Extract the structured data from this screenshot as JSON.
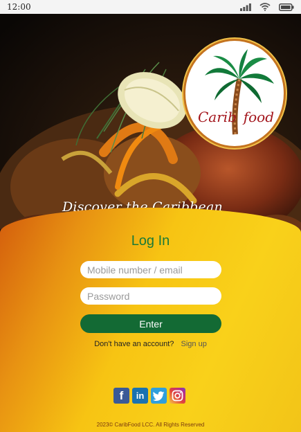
{
  "status_bar": {
    "time": "12:00"
  },
  "brand": {
    "logo_text_left": "Carib",
    "logo_text_right": "food",
    "tagline": "Discover the Caribbean Flava"
  },
  "login": {
    "title": "Log In",
    "username_placeholder": "Mobile number / email",
    "password_placeholder": "Password",
    "submit_label": "Enter",
    "signup_prompt": "Don't have an account?",
    "signup_link": "Sign up"
  },
  "socials": [
    "facebook-icon",
    "linkedin-icon",
    "twitter-icon",
    "instagram-icon"
  ],
  "footer": {
    "copyright": "2023© CaribFood LCC. All Rights Reserved"
  },
  "colors": {
    "brand_green": "#136a34",
    "title_green": "#1b7a38",
    "logo_red": "#a3151c",
    "panel_yellow": "#f9d11a",
    "panel_orange": "#d35c0d"
  }
}
